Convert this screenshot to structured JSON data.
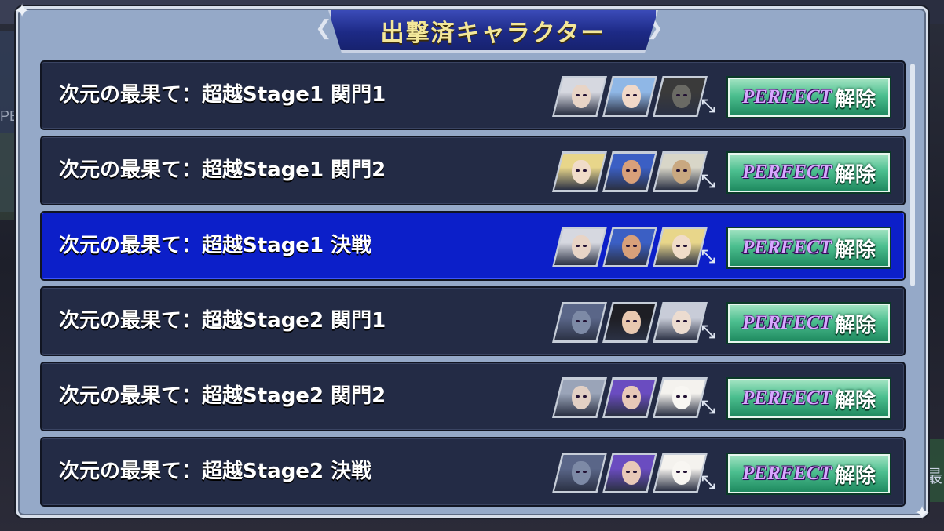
{
  "title": "出撃済キャラクター",
  "button": {
    "perfect": "Perfect",
    "unlock": "解除"
  },
  "background": {
    "left_fragment": "PE",
    "right_fragment": "最"
  },
  "rows": [
    {
      "label": "次元の最果て：超越Stage1 関門1",
      "selected": false,
      "portraits": [
        {
          "hair": "#d6d8e0",
          "skin": "#e8d4c6"
        },
        {
          "hair": "#8fb7e6",
          "skin": "#f0d8c8"
        },
        {
          "hair": "#3a3a3a",
          "skin": "#6a6a64"
        }
      ]
    },
    {
      "label": "次元の最果て：超越Stage1 関門2",
      "selected": false,
      "portraits": [
        {
          "hair": "#e8d68a",
          "skin": "#f0dcc8"
        },
        {
          "hair": "#3b5fc4",
          "skin": "#d8a07a"
        },
        {
          "hair": "#d8d6c8",
          "skin": "#c9a880"
        }
      ]
    },
    {
      "label": "次元の最果て：超越Stage1 決戦",
      "selected": true,
      "portraits": [
        {
          "hair": "#d6d8e0",
          "skin": "#e8d4c6"
        },
        {
          "hair": "#3b5fc4",
          "skin": "#d8a07a"
        },
        {
          "hair": "#e8d68a",
          "skin": "#f0dcc8"
        }
      ]
    },
    {
      "label": "次元の最果て：超越Stage2 関門1",
      "selected": false,
      "portraits": [
        {
          "hair": "#5a6688",
          "skin": "#7d8aa6"
        },
        {
          "hair": "#1e1e24",
          "skin": "#e8c8b0"
        },
        {
          "hair": "#c8ccd8",
          "skin": "#ecdcd0"
        }
      ]
    },
    {
      "label": "次元の最果て：超越Stage2 関門2",
      "selected": false,
      "portraits": [
        {
          "hair": "#9aa4b8",
          "skin": "#e2d0c4"
        },
        {
          "hair": "#6a4cc0",
          "skin": "#e8c8b8"
        },
        {
          "hair": "#f4f2ee",
          "skin": "#f8f6f2"
        }
      ]
    },
    {
      "label": "次元の最果て：超越Stage2 決戦",
      "selected": false,
      "portraits": [
        {
          "hair": "#5a6688",
          "skin": "#7d8aa6"
        },
        {
          "hair": "#6a4cc0",
          "skin": "#e8c8b8"
        },
        {
          "hair": "#f4f2ee",
          "skin": "#f8f6f2"
        }
      ]
    }
  ]
}
